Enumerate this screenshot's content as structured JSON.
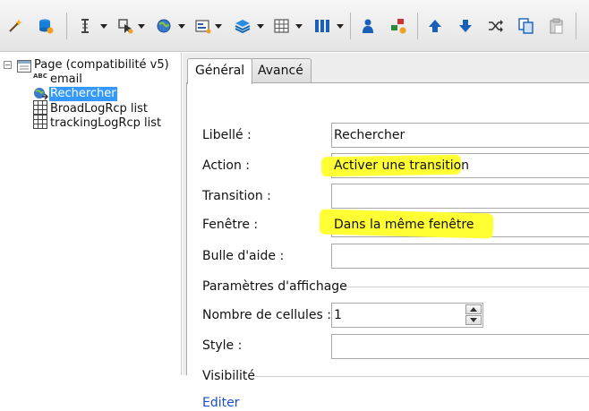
{
  "toolbar": {
    "buttons": [
      {
        "name": "magic-wand-icon",
        "color": "#e0a020"
      },
      {
        "name": "database-add-icon",
        "color": "#1a7fd6"
      },
      {
        "name": "text-cursor-icon",
        "color": "#444444"
      },
      {
        "name": "cursor-select-icon",
        "color": "#555555"
      },
      {
        "name": "globe-icon",
        "color": "#2a5fb0"
      },
      {
        "name": "form-icon",
        "color": "#2a5fb0"
      },
      {
        "name": "layers-icon",
        "color": "#1a6fc0"
      },
      {
        "name": "table-icon",
        "color": "#555555"
      },
      {
        "name": "columns-icon",
        "color": "#1a5fb8"
      },
      {
        "name": "user-icon",
        "color": "#1a5fb8"
      },
      {
        "name": "shapes-add-icon",
        "color": "#cc3333"
      },
      {
        "name": "arrow-up-icon",
        "color": "#1a5fb8"
      },
      {
        "name": "arrow-down-icon",
        "color": "#1a5fb8"
      },
      {
        "name": "shuffle-icon",
        "color": "#333333"
      },
      {
        "name": "copy-icon",
        "color": "#1a5fb8"
      },
      {
        "name": "paste-icon",
        "color": "#999999"
      }
    ]
  },
  "tree": {
    "root": {
      "label": "Page (compatibilité v5)"
    },
    "children": [
      {
        "label": "email",
        "icon": "abc-text-icon",
        "icon_text": "ABC",
        "selected": false
      },
      {
        "label": "Rechercher",
        "icon": "globe-link-icon",
        "selected": true
      },
      {
        "label": "BroadLogRcp list",
        "icon": "grid-list-icon",
        "selected": false
      },
      {
        "label": "trackingLogRcp list",
        "icon": "grid-list-icon",
        "selected": false
      }
    ]
  },
  "tabs": [
    {
      "label": "Général",
      "active": true
    },
    {
      "label": "Avancé",
      "active": false
    }
  ],
  "form": {
    "label_label": "Libellé :",
    "label_value": "Rechercher",
    "action_label": "Action :",
    "action_value": "Activer une transition",
    "transition_label": "Transition :",
    "transition_value": "",
    "window_label": "Fenêtre :",
    "window_value": "Dans la même fenêtre",
    "tooltip_label": "Bulle d'aide :",
    "tooltip_value": "",
    "display_group": "Paramètres d'affichage",
    "cells_label": "Nombre de cellules :",
    "cells_value": "1",
    "style_label": "Style :",
    "style_value": "",
    "visibility_group": "Visibilité",
    "edit_link": "Editer"
  },
  "colors": {
    "highlight": "#ffff33",
    "selection": "#3399ff",
    "link": "#1a4ccf"
  }
}
